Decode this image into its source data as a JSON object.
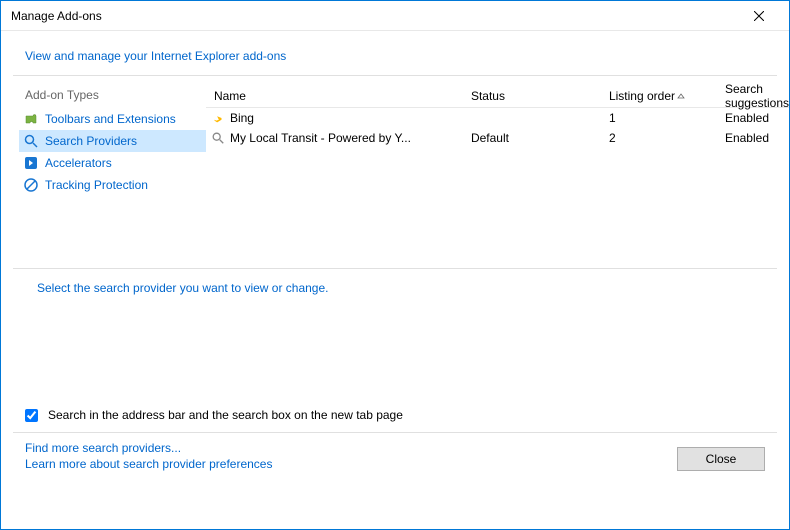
{
  "window": {
    "title": "Manage Add-ons"
  },
  "header": {
    "link": "View and manage your Internet Explorer add-ons"
  },
  "sidebar": {
    "header": "Add-on Types",
    "items": [
      {
        "label": "Toolbars and Extensions"
      },
      {
        "label": "Search Providers"
      },
      {
        "label": "Accelerators"
      },
      {
        "label": "Tracking Protection"
      }
    ]
  },
  "table": {
    "columns": {
      "name": "Name",
      "status": "Status",
      "order": "Listing order",
      "suggestions": "Search suggestions"
    },
    "rows": [
      {
        "name": "Bing",
        "status": "",
        "order": "1",
        "suggestions": "Enabled"
      },
      {
        "name": "My Local Transit - Powered by Y...",
        "status": "Default",
        "order": "2",
        "suggestions": "Enabled"
      }
    ]
  },
  "hint": "Select the search provider you want to view or change.",
  "checkbox": {
    "label": "Search in the address bar and the search box on the new tab page"
  },
  "footer": {
    "link1": "Find more search providers...",
    "link2": "Learn more about search provider preferences",
    "close": "Close"
  }
}
